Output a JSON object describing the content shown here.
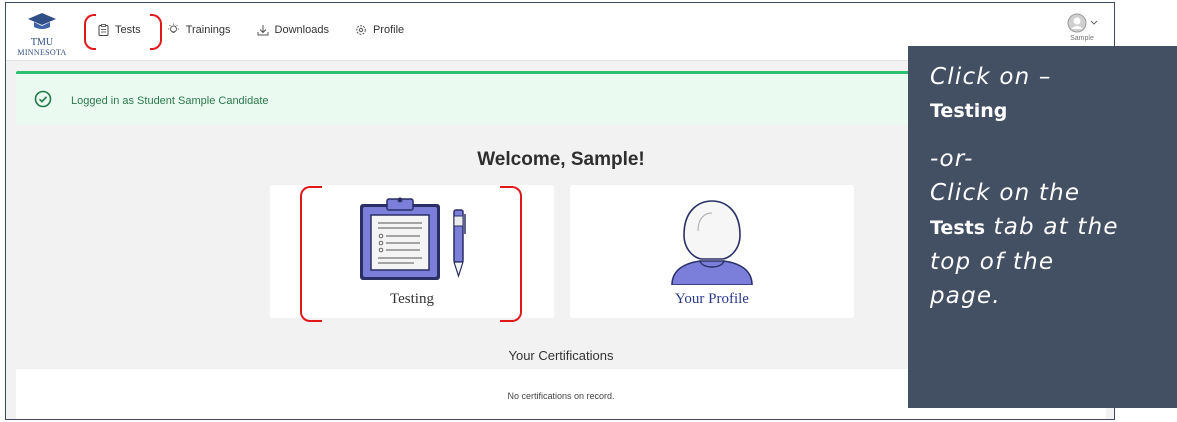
{
  "logo": {
    "line1": "TMU",
    "line2": "MINNESOTA"
  },
  "nav": [
    {
      "label": "Tests",
      "icon": "clipboard-icon"
    },
    {
      "label": "Trainings",
      "icon": "lightbulb-icon"
    },
    {
      "label": "Downloads",
      "icon": "download-icon"
    },
    {
      "label": "Profile",
      "icon": "gear-icon"
    }
  ],
  "account": {
    "name": "Sample"
  },
  "banner": {
    "text": "Logged in as Student Sample Candidate"
  },
  "welcome": "Welcome, Sample!",
  "cards": {
    "testing": "Testing",
    "profile": "Your Profile"
  },
  "certifications": {
    "title": "Your Certifications",
    "empty": "No certifications on record."
  },
  "callout": {
    "line1": "Click on –",
    "line2": "Testing",
    "line3": "-or-",
    "line4": "Click on the",
    "line5_bold": "Tests",
    "line5_rest": " tab at the",
    "line6": "top of the",
    "line7": "page."
  },
  "colors": {
    "accent_red": "#e01818",
    "banner_green": "#2fbf71",
    "callout_bg": "#435064",
    "card_icon": "#7b7fd9"
  }
}
